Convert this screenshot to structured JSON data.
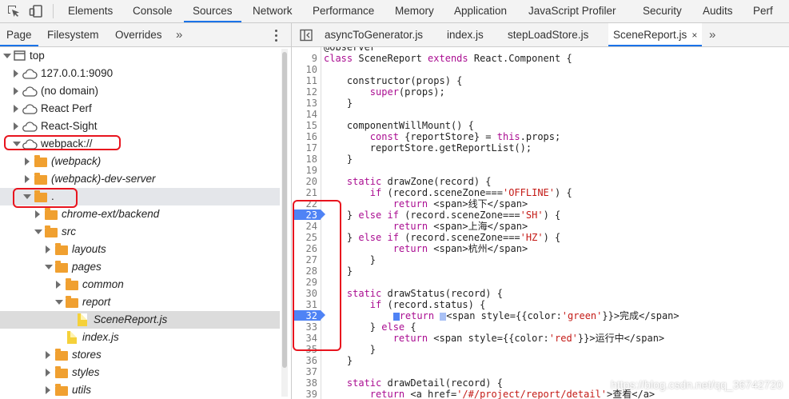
{
  "toolbar": {
    "tabs": [
      "Elements",
      "Console",
      "Sources",
      "Network",
      "Performance",
      "Memory",
      "Application",
      "JavaScript Profiler",
      "Security",
      "Audits",
      "Perf"
    ],
    "active_tab": "Sources"
  },
  "navigator": {
    "tabs": [
      "Page",
      "Filesystem",
      "Overrides"
    ],
    "active_tab": "Page",
    "more": "»",
    "tree": [
      {
        "label": "top"
      },
      {
        "label": "127.0.0.1:9090"
      },
      {
        "label": "(no domain)"
      },
      {
        "label": "React Perf"
      },
      {
        "label": "React-Sight"
      },
      {
        "label": "webpack://"
      },
      {
        "label": "(webpack)"
      },
      {
        "label": "(webpack)-dev-server"
      },
      {
        "label": "."
      },
      {
        "label": "chrome-ext/backend"
      },
      {
        "label": "src"
      },
      {
        "label": "layouts"
      },
      {
        "label": "pages"
      },
      {
        "label": "common"
      },
      {
        "label": "report"
      },
      {
        "label": "SceneReport.js"
      },
      {
        "label": "index.js"
      },
      {
        "label": "stores"
      },
      {
        "label": "styles"
      },
      {
        "label": "utils"
      }
    ]
  },
  "editor": {
    "file_tabs": [
      {
        "label": "asyncToGenerator.js"
      },
      {
        "label": "index.js"
      },
      {
        "label": "stepLoadStore.js"
      },
      {
        "label": "SceneReport.js",
        "close": "×"
      }
    ],
    "more": "»",
    "breakpoints": [
      "23",
      "32"
    ]
  },
  "watermark": "https://blog.csdn.net/qq_36742720",
  "colors": {
    "accent": "#1a73e8",
    "breakpoint": "#4f83f5",
    "annotation": "#e8141e"
  }
}
